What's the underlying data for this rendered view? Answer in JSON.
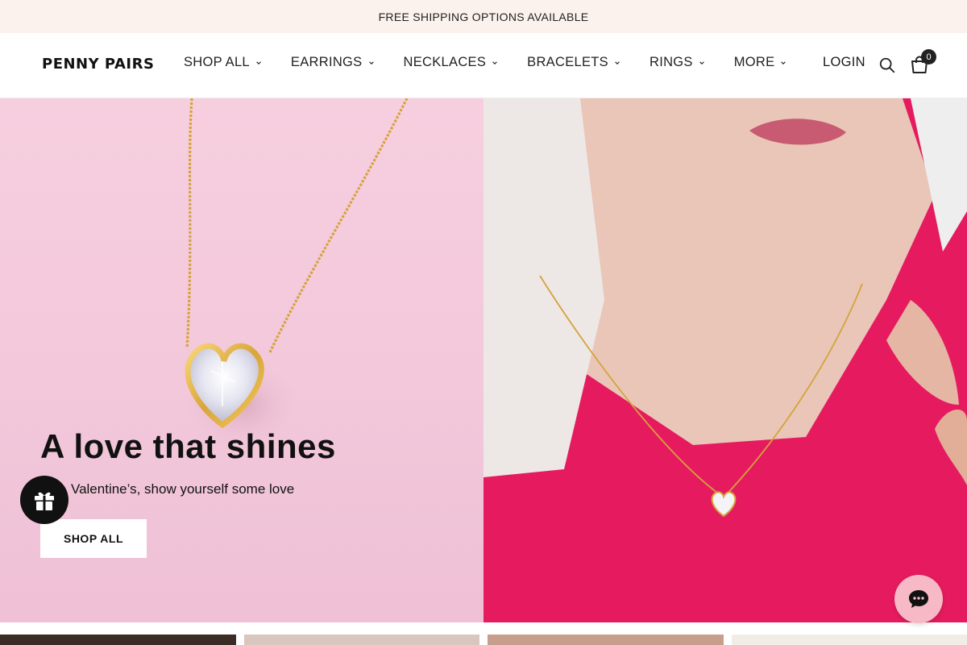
{
  "announcement": {
    "text": "FREE SHIPPING OPTIONS AVAILABLE"
  },
  "header": {
    "logo": "PENNY PAIRS",
    "nav": [
      {
        "label": "SHOP ALL"
      },
      {
        "label": "EARRINGS"
      },
      {
        "label": "NECKLACES"
      },
      {
        "label": "BRACELETS"
      },
      {
        "label": "RINGS"
      },
      {
        "label": "MORE"
      }
    ],
    "login": "LOGIN",
    "cart_count": "0"
  },
  "hero": {
    "title": "A love that shines",
    "subtitle": "Valentine’s, show yourself some love",
    "cta": "SHOP ALL"
  },
  "icons": {
    "search": "search-icon",
    "cart": "cart-icon",
    "gift": "gift-icon",
    "chat": "chat-icon",
    "chevron": "chevron-down-icon"
  },
  "colors": {
    "announcement_bg": "#fbf2ee",
    "hero_left_bg": "#f2c7da",
    "hero_right_accent": "#e81a62",
    "chat_button": "#f7b9c6",
    "gift_button": "#111111"
  }
}
